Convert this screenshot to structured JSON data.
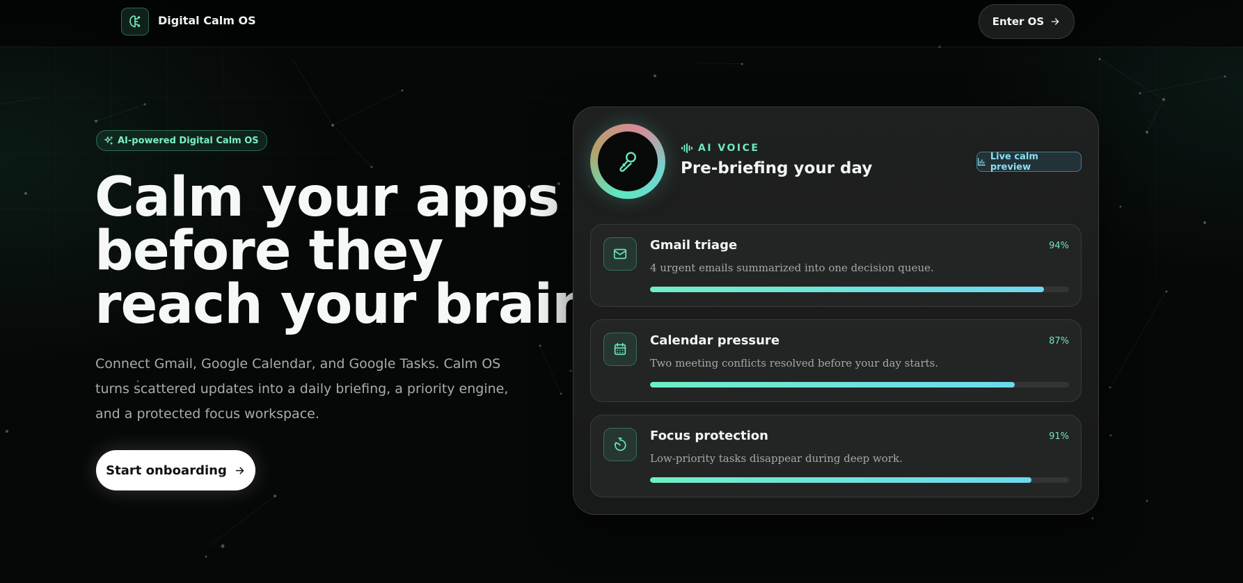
{
  "header": {
    "brand": "Digital Calm OS",
    "enter_label": "Enter OS"
  },
  "hero": {
    "badge": "AI-powered Digital Calm OS",
    "title_lines": [
      "Calm your apps",
      "before they",
      "reach your brain."
    ],
    "description": "Connect Gmail, Google Calendar, and Google Tasks. Calm OS turns scattered updates into a daily briefing, a priority engine, and a protected focus workspace.",
    "cta_label": "Start onboarding"
  },
  "card": {
    "eyebrow": "AI VOICE",
    "title": "Pre-briefing your day",
    "live_badge": "Live calm preview",
    "items": [
      {
        "icon": "mail-icon",
        "title": "Gmail triage",
        "percent_label": "94%",
        "progress": 0.94,
        "description": "4 urgent emails summarized into one decision queue."
      },
      {
        "icon": "calendar-icon",
        "title": "Calendar pressure",
        "percent_label": "87%",
        "progress": 0.87,
        "description": "Two meeting conflicts resolved before your day starts."
      },
      {
        "icon": "timer-icon",
        "title": "Focus protection",
        "percent_label": "91%",
        "progress": 0.91,
        "description": "Low-priority tasks disappear during deep work."
      }
    ]
  },
  "colors": {
    "accent_mint": "#6ee9bf",
    "accent_cyan": "#6ed8ef",
    "background": "#060707"
  }
}
